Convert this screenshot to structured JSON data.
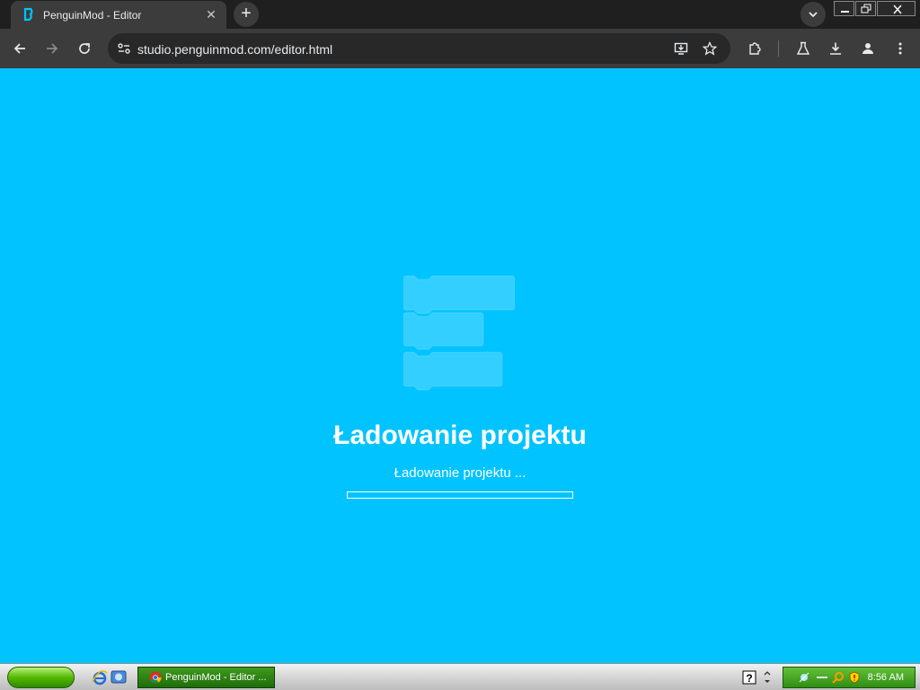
{
  "browser": {
    "tab_title": "PenguinMod - Editor",
    "tab_close_icon": "close-icon",
    "new_tab_label": "+",
    "url": "studio.penguinmod.com/editor.html",
    "accent_color": "#3c3c3c"
  },
  "page": {
    "background_color": "#00c3ff",
    "heading": "Ładowanie projektu",
    "message": "Ładowanie projektu ...",
    "progress": 0.0
  },
  "taskbar": {
    "task_label": "PenguinMod - Editor ...",
    "clock": "8:56 AM"
  }
}
